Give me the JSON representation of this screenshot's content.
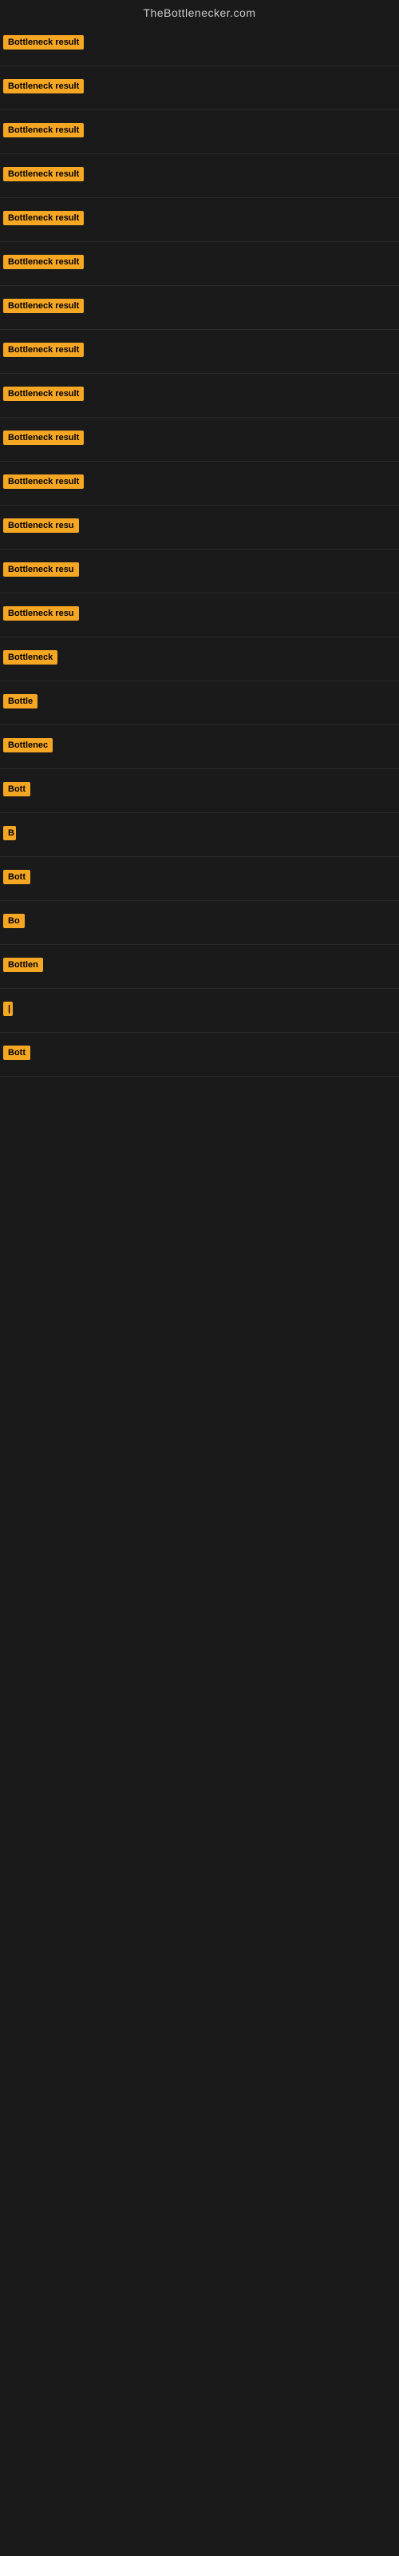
{
  "header": {
    "site_title": "TheBottlenecker.com"
  },
  "accent_color": "#f5a623",
  "rows": [
    {
      "label": "Bottleneck result",
      "width": 155
    },
    {
      "label": "Bottleneck result",
      "width": 155
    },
    {
      "label": "Bottleneck result",
      "width": 155
    },
    {
      "label": "Bottleneck result",
      "width": 155
    },
    {
      "label": "Bottleneck result",
      "width": 155
    },
    {
      "label": "Bottleneck result",
      "width": 155
    },
    {
      "label": "Bottleneck result",
      "width": 155
    },
    {
      "label": "Bottleneck result",
      "width": 155
    },
    {
      "label": "Bottleneck result",
      "width": 155
    },
    {
      "label": "Bottleneck result",
      "width": 155
    },
    {
      "label": "Bottleneck result",
      "width": 155
    },
    {
      "label": "Bottleneck resu",
      "width": 140
    },
    {
      "label": "Bottleneck resu",
      "width": 140
    },
    {
      "label": "Bottleneck resu",
      "width": 140
    },
    {
      "label": "Bottleneck",
      "width": 100
    },
    {
      "label": "Bottle",
      "width": 55
    },
    {
      "label": "Bottlenec",
      "width": 85
    },
    {
      "label": "Bott",
      "width": 42
    },
    {
      "label": "B",
      "width": 16
    },
    {
      "label": "Bott",
      "width": 42
    },
    {
      "label": "Bo",
      "width": 28
    },
    {
      "label": "Bottlen",
      "width": 68
    },
    {
      "label": "|",
      "width": 10
    },
    {
      "label": "Bott",
      "width": 42
    }
  ]
}
